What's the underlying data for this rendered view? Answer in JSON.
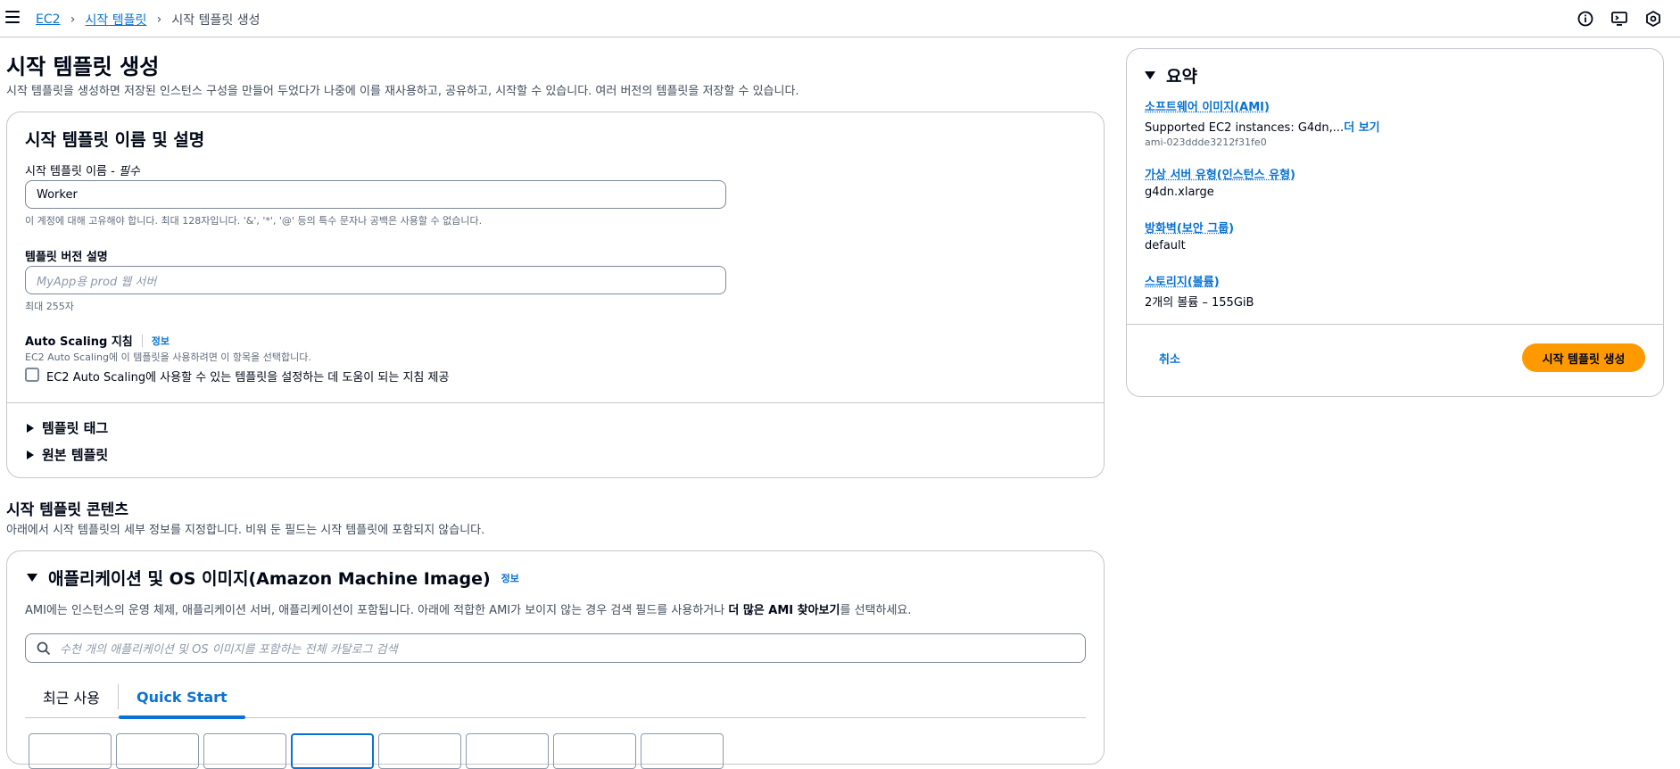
{
  "breadcrumb": {
    "items": [
      "EC2",
      "시작 템플릿"
    ],
    "current": "시작 템플릿 생성"
  },
  "header_icons": [
    "info-icon",
    "cloudshell-icon",
    "settings-icon"
  ],
  "page": {
    "title": "시작 템플릿 생성",
    "description": "시작 템플릿을 생성하면 저장된 인스턴스 구성을 만들어 두었다가 나중에 이를 재사용하고, 공유하고, 시작할 수 있습니다. 여러 버전의 템플릿을 저장할 수 있습니다."
  },
  "name_section": {
    "title": "시작 템플릿 이름 및 설명",
    "name_label": "시작 템플릿 이름 - ",
    "name_required": "필수",
    "name_value": "Worker",
    "name_hint": "이 계정에 대해 고유해야 합니다. 최대 128자입니다. '&', '*', '@' 등의 특수 문자나 공백은 사용할 수 없습니다.",
    "version_label": "템플릿 버전 설명",
    "version_placeholder": "MyApp용 prod 웹 서버",
    "version_hint": "최대 255자",
    "asg_label": "Auto Scaling 지침",
    "asg_info": "정보",
    "asg_desc": "EC2 Auto Scaling에 이 템플릿을 사용하려면 이 항목을 선택합니다.",
    "asg_checkbox_label": "EC2 Auto Scaling에 사용할 수 있는 템플릿을 설정하는 데 도움이 되는 지침 제공",
    "asg_checked": false,
    "tags_label": "템플릿 태그",
    "source_label": "원본 템플릿"
  },
  "content_section": {
    "title": "시작 템플릿 콘텐츠",
    "description": "아래에서 시작 템플릿의 세부 정보를 지정합니다. 비워 둔 필드는 시작 템플릿에 포함되지 않습니다."
  },
  "ami_section": {
    "title": "애플리케이션 및 OS 이미지(Amazon Machine Image)",
    "info": "정보",
    "desc_prefix": "AMI에는 인스턴스의 운영 체제, 애플리케이션 서버, 애플리케이션이 포함됩니다. 아래에 적합한 AMI가 보이지 않는 경우 검색 필드를 사용하거나 ",
    "desc_bold": "더 많은 AMI 찾아보기",
    "desc_suffix": "를 선택하세요.",
    "search_placeholder": "수천 개의 애플리케이션 및 OS 이미지를 포함하는 전체 카탈로그 검색",
    "tabs": [
      "최근 사용",
      "Quick Start"
    ],
    "active_tab": "Quick Start",
    "tile_count": 8,
    "selected_tile": 4
  },
  "summary": {
    "title": "요약",
    "ami_key": "소프트웨어 이미지(AMI)",
    "ami_value": "Supported EC2 instances: G4dn,...",
    "ami_more": "더 보기",
    "ami_id": "ami-023ddde3212f31fe0",
    "type_key": "가상 서버 유형(인스턴스 유형)",
    "type_value": "g4dn.xlarge",
    "firewall_key": "방화벽(보안 그룹)",
    "firewall_value": "default",
    "storage_key": "스토리지(볼륨)",
    "storage_value": "2개의 볼륨 – 155GiB",
    "cancel_label": "취소",
    "create_label": "시작 템플릿 생성"
  },
  "colors": {
    "link": "#0972d3",
    "primary_button": "#ff9900",
    "border": "#c6c6cd",
    "text": "#000716"
  }
}
